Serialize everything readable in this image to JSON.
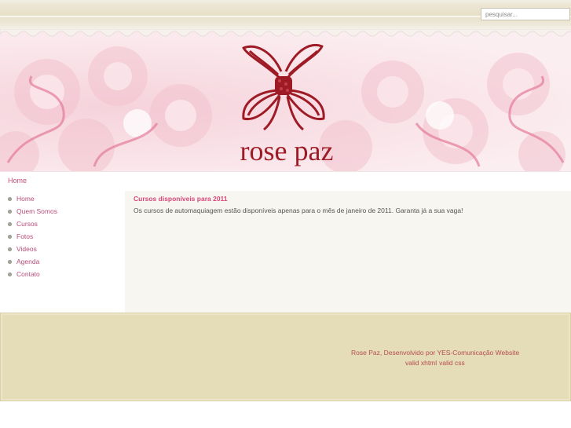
{
  "header": {
    "search_placeholder": "pesquisar..."
  },
  "banner": {
    "brand": "rose paz",
    "logo_icon": "bow-logo-icon",
    "colors": {
      "brand": "#9e1b26",
      "background": "#f8e1e7"
    }
  },
  "breadcrumb": {
    "current": "Home"
  },
  "sidebar": {
    "items": [
      {
        "label": "Home"
      },
      {
        "label": "Quem Somos"
      },
      {
        "label": "Cursos"
      },
      {
        "label": "Fotos"
      },
      {
        "label": "Videos"
      },
      {
        "label": "Agenda"
      },
      {
        "label": "Contato"
      }
    ]
  },
  "article": {
    "title": "Cursos disponíveis para 2011",
    "body": "Os cursos de automaquiagem estão disponíveis apenas para o mês de janeiro de 2011. Garanta já a sua vaga!"
  },
  "footer": {
    "credit": "Rose Paz, Desenvolvido por YES-Comunicação Website",
    "valid_xhtml": "valid xhtml",
    "valid_css": "valid css"
  },
  "colors": {
    "link": "#b44e78",
    "title_accent": "#d8467a",
    "footer_bg": "#e5dcb8",
    "footer_text": "#b44e4e"
  }
}
